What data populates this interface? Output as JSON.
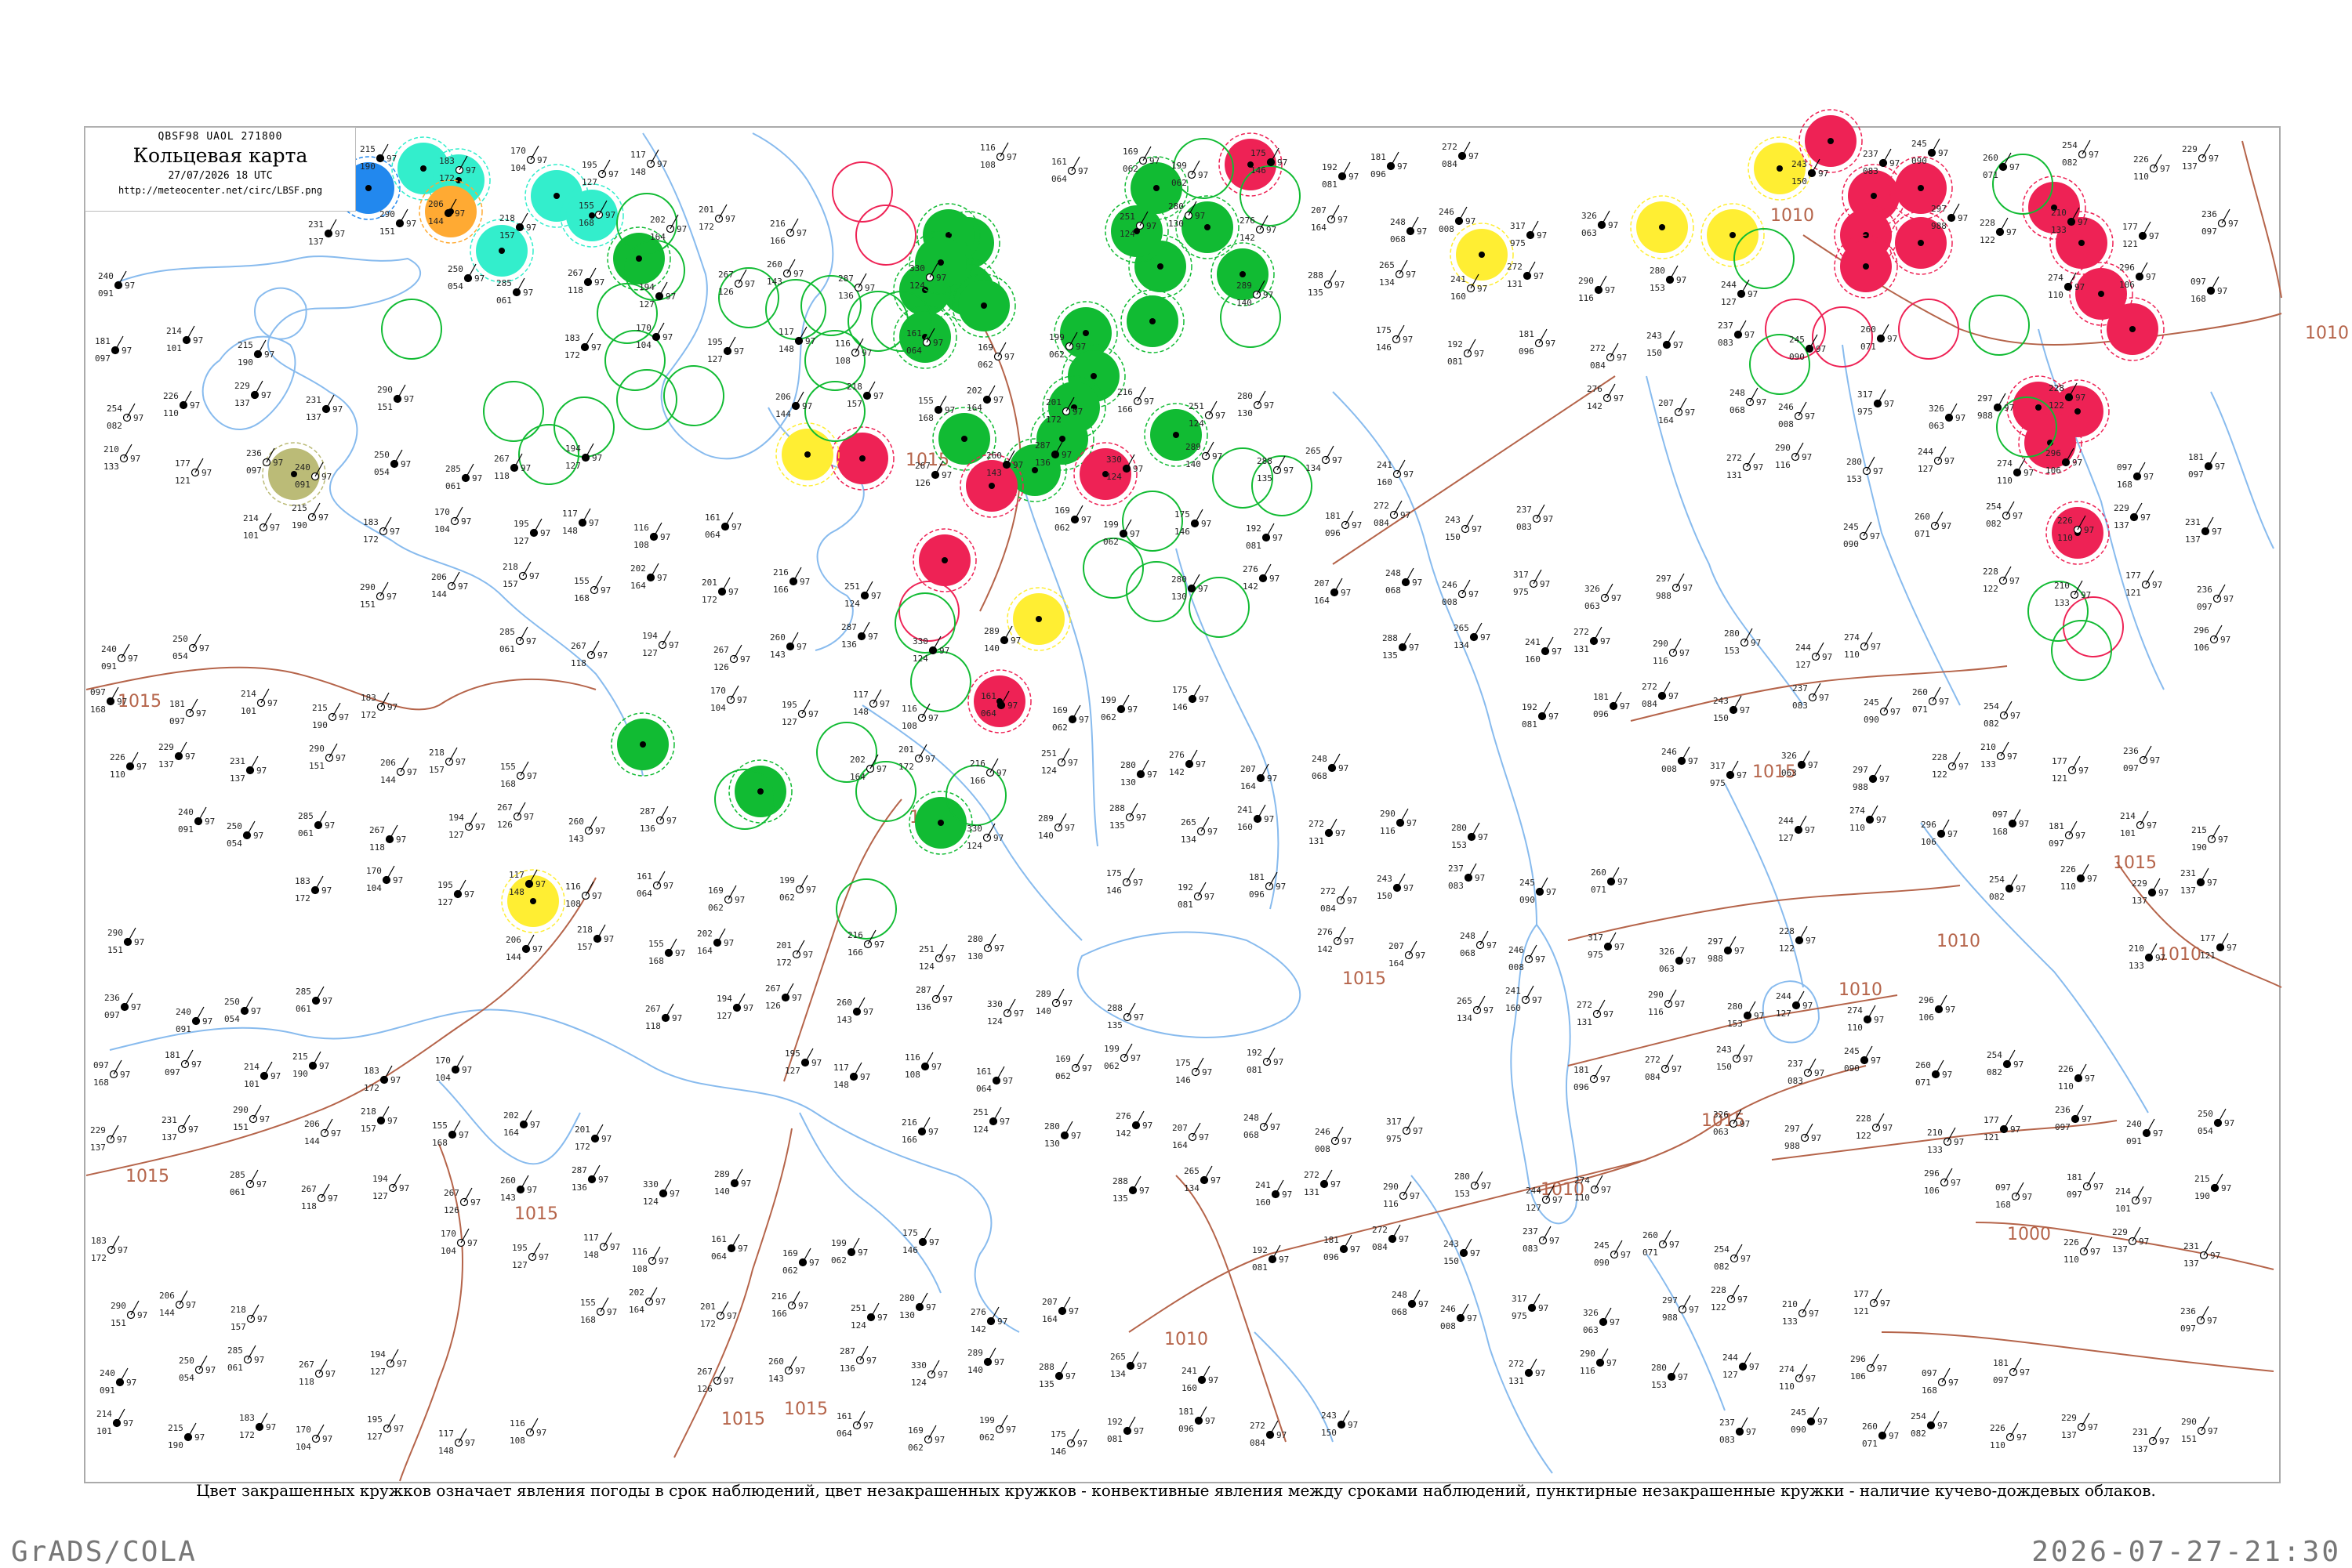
{
  "header": {
    "code_line": "QBSF98  UAOL  271800",
    "title": "Кольцевая карта",
    "valid_time": "27/07/2026 18 UTC",
    "url": "http://meteocenter.net/circ/LBSF.png"
  },
  "footer": {
    "caption": "Цвет закрашенных кружков означает явления погоды в срок наблюдений, цвет незакрашенных кружков - конвективные явления между сроками наблюдений, пунктирные незакрашенные кружки - наличие кучево-дождевых облаков.",
    "software": "GrADS/COLA",
    "generated": "2026-07-27-21:30"
  },
  "isobar_labels": [
    "1010",
    "1015",
    "1015",
    "1015",
    "1015",
    "1015",
    "1010",
    "1010",
    "1015",
    "1015",
    "1000",
    "1015",
    "1015",
    "1010",
    "1010",
    "1015",
    "1010",
    "1015",
    "1010"
  ],
  "colors": {
    "thunderstorm": "#11bb33",
    "heavy_rain_or_storm": "#ee2255",
    "shower": "#ffee33",
    "hail_or_dust": "#33eecc",
    "fog": "#ffaa33",
    "snow": "#2288ee",
    "haze": "#bbbb77",
    "isobar": "#b5644a",
    "rivers": "#88bbee",
    "coastline": "#88bbee"
  },
  "stations": [
    {
      "p": "097",
      "t": "168"
    },
    {
      "p": "181",
      "t": "097"
    },
    {
      "p": "214",
      "t": "101"
    },
    {
      "p": "215",
      "t": "190"
    },
    {
      "p": "183",
      "t": "172"
    },
    {
      "p": "170",
      "t": "104"
    },
    {
      "p": "195",
      "t": "127"
    },
    {
      "p": "117",
      "t": "148"
    },
    {
      "p": "116",
      "t": "108"
    },
    {
      "p": "161",
      "t": "064"
    },
    {
      "p": "169",
      "t": "062"
    },
    {
      "p": "199",
      "t": "062"
    },
    {
      "p": "175",
      "t": "146"
    },
    {
      "p": "192",
      "t": "081"
    },
    {
      "p": "181",
      "t": "096"
    },
    {
      "p": "272",
      "t": "084"
    },
    {
      "p": "243",
      "t": "150"
    },
    {
      "p": "237",
      "t": "083"
    },
    {
      "p": "245",
      "t": "090"
    },
    {
      "p": "260",
      "t": "071"
    },
    {
      "p": "254",
      "t": "082"
    },
    {
      "p": "226",
      "t": "110"
    },
    {
      "p": "229",
      "t": "137"
    },
    {
      "p": "231",
      "t": "137"
    },
    {
      "p": "290",
      "t": "151"
    },
    {
      "p": "206",
      "t": "144"
    },
    {
      "p": "218",
      "t": "157"
    },
    {
      "p": "155",
      "t": "168"
    },
    {
      "p": "202",
      "t": "164"
    },
    {
      "p": "201",
      "t": "172"
    },
    {
      "p": "216",
      "t": "166"
    },
    {
      "p": "251",
      "t": "124"
    },
    {
      "p": "280",
      "t": "130"
    },
    {
      "p": "276",
      "t": "142"
    },
    {
      "p": "207",
      "t": "164"
    },
    {
      "p": "248",
      "t": "068"
    },
    {
      "p": "246",
      "t": "008"
    },
    {
      "p": "317",
      "t": "975"
    },
    {
      "p": "326",
      "t": "063"
    },
    {
      "p": "297",
      "t": "988"
    },
    {
      "p": "228",
      "t": "122"
    },
    {
      "p": "210",
      "t": "133"
    },
    {
      "p": "177",
      "t": "121"
    },
    {
      "p": "236",
      "t": "097"
    },
    {
      "p": "240",
      "t": "091"
    },
    {
      "p": "250",
      "t": "054"
    },
    {
      "p": "285",
      "t": "061"
    },
    {
      "p": "267",
      "t": "118"
    },
    {
      "p": "194",
      "t": "127"
    },
    {
      "p": "267",
      "t": "126"
    },
    {
      "p": "260",
      "t": "143"
    },
    {
      "p": "287",
      "t": "136"
    },
    {
      "p": "330",
      "t": "124"
    },
    {
      "p": "289",
      "t": "140"
    },
    {
      "p": "288",
      "t": "135"
    },
    {
      "p": "265",
      "t": "134"
    },
    {
      "p": "241",
      "t": "160"
    },
    {
      "p": "272",
      "t": "131"
    },
    {
      "p": "290",
      "t": "116"
    },
    {
      "p": "280",
      "t": "153"
    },
    {
      "p": "244",
      "t": "127"
    },
    {
      "p": "274",
      "t": "110"
    },
    {
      "p": "296",
      "t": "106"
    }
  ]
}
